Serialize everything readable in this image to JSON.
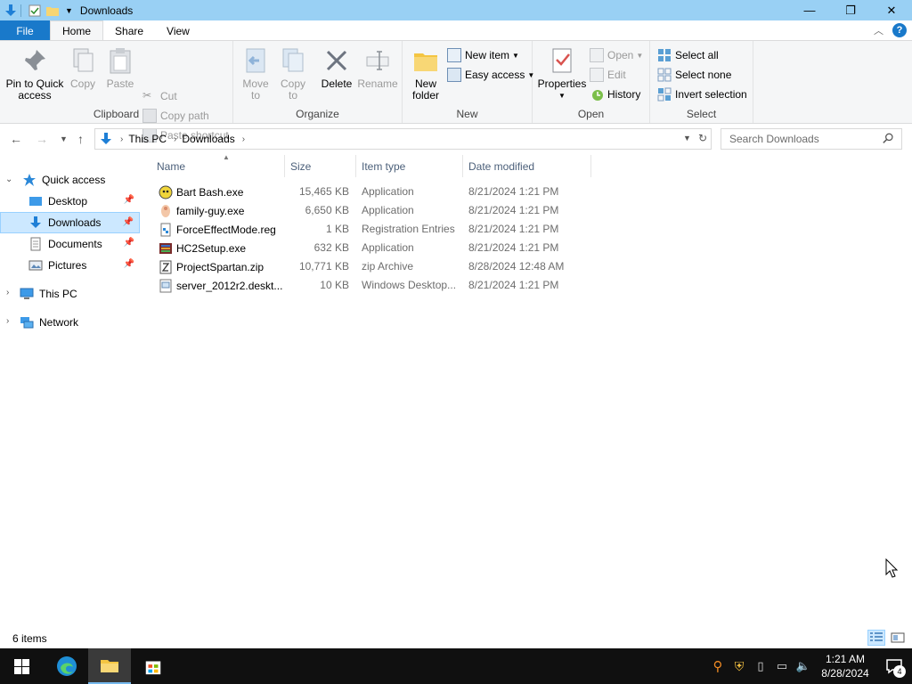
{
  "window": {
    "title": "Downloads",
    "controls": {
      "minimize": "—",
      "maximize": "❐",
      "close": "✕"
    }
  },
  "tabs": [
    {
      "label": "File"
    },
    {
      "label": "Home"
    },
    {
      "label": "Share"
    },
    {
      "label": "View"
    }
  ],
  "ribbon": {
    "clipboard": {
      "group_label": "Clipboard",
      "pin_line1": "Pin to Quick",
      "pin_line2": "access",
      "copy": "Copy",
      "paste": "Paste",
      "cut": "Cut",
      "copy_path": "Copy path",
      "paste_shortcut": "Paste shortcut"
    },
    "organize": {
      "group_label": "Organize",
      "move_to_line1": "Move",
      "move_to_line2": "to",
      "copy_to_line1": "Copy",
      "copy_to_line2": "to",
      "delete": "Delete",
      "rename": "Rename"
    },
    "new": {
      "group_label": "New",
      "new_folder_line1": "New",
      "new_folder_line2": "folder",
      "new_item": "New item",
      "easy_access": "Easy access"
    },
    "open": {
      "group_label": "Open",
      "properties": "Properties",
      "open": "Open",
      "edit": "Edit",
      "history": "History"
    },
    "select": {
      "group_label": "Select",
      "select_all": "Select all",
      "select_none": "Select none",
      "invert_selection": "Invert selection"
    }
  },
  "address": {
    "crumbs": [
      "This PC",
      "Downloads"
    ]
  },
  "search": {
    "placeholder": "Search Downloads"
  },
  "nav": {
    "quick_access": "Quick access",
    "items": [
      {
        "label": "Desktop"
      },
      {
        "label": "Downloads"
      },
      {
        "label": "Documents"
      },
      {
        "label": "Pictures"
      }
    ],
    "this_pc": "This PC",
    "network": "Network"
  },
  "columns": {
    "name": "Name",
    "size": "Size",
    "type": "Item type",
    "date": "Date modified"
  },
  "files": [
    {
      "name": "Bart Bash.exe",
      "size": "15,465 KB",
      "type": "Application",
      "date": "8/21/2024 1:21 PM",
      "icon": "bart-app-icon"
    },
    {
      "name": "family-guy.exe",
      "size": "6,650 KB",
      "type": "Application",
      "date": "8/21/2024 1:21 PM",
      "icon": "family-guy-app-icon"
    },
    {
      "name": "ForceEffectMode.reg",
      "size": "1 KB",
      "type": "Registration Entries",
      "date": "8/21/2024 1:21 PM",
      "icon": "registry-file-icon"
    },
    {
      "name": "HC2Setup.exe",
      "size": "632 KB",
      "type": "Application",
      "date": "8/21/2024 1:21 PM",
      "icon": "installer-icon"
    },
    {
      "name": "ProjectSpartan.zip",
      "size": "10,771 KB",
      "type": "zip Archive",
      "date": "8/28/2024 12:48 AM",
      "icon": "zip-file-icon"
    },
    {
      "name": "server_2012r2.deskt...",
      "size": "10 KB",
      "type": "Windows Desktop...",
      "date": "8/21/2024 1:21 PM",
      "icon": "theme-file-icon"
    }
  ],
  "status": {
    "item_count": "6 items"
  },
  "taskbar": {
    "time": "1:21 AM",
    "date": "8/28/2024",
    "notification_count": "4"
  },
  "colors": {
    "titlebar": "#99d0f4",
    "file_tab": "#1979ca",
    "selection": "#cce8ff",
    "taskbar": "#101010"
  }
}
